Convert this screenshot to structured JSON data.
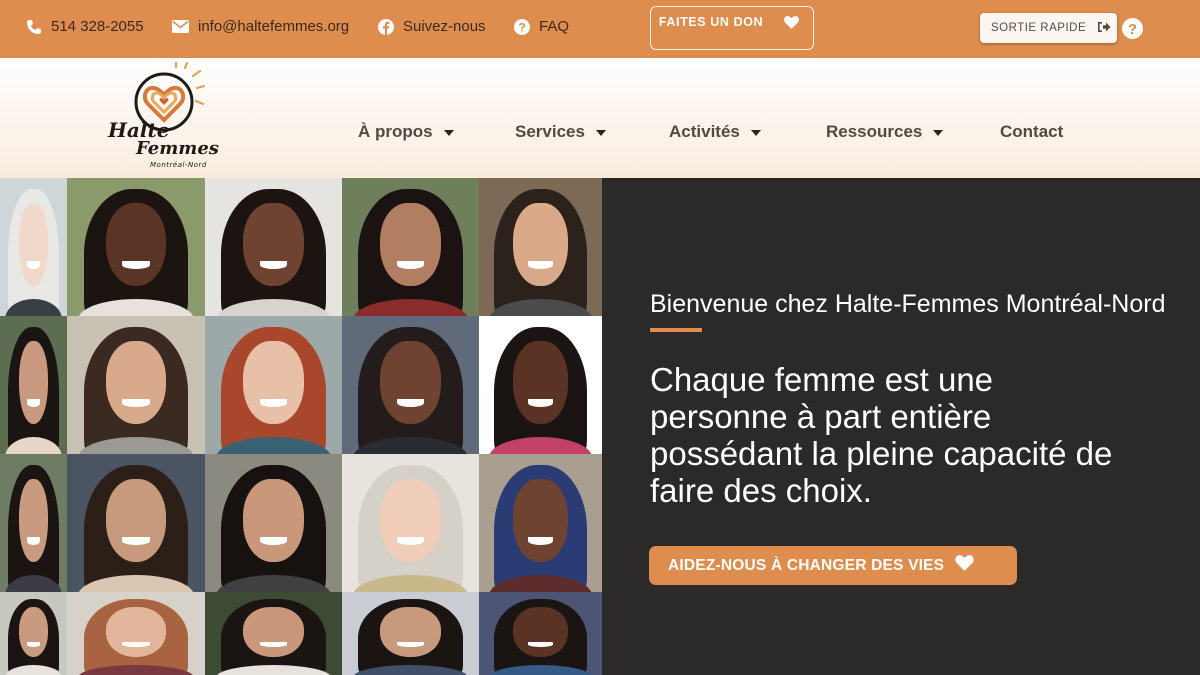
{
  "topbar": {
    "phone": "514 328-2055",
    "email": "info@haltefemmes.org",
    "social": "Suivez-nous",
    "faq": "FAQ",
    "donate_label": "FAITES UN DON",
    "quick_exit_label": "SORTIE RAPIDE"
  },
  "logo": {
    "text_line1": "Halte",
    "text_line2": "Femmes",
    "text_line3": "Montréal-Nord"
  },
  "nav": [
    {
      "label": "À propos"
    },
    {
      "label": "Services"
    },
    {
      "label": "Activités"
    },
    {
      "label": "Ressources"
    },
    {
      "label": "Contact"
    }
  ],
  "hero": {
    "welcome": "Bienvenue chez Halte-Femmes Montréal-Nord",
    "quote": "Chaque femme est une\npersonne à part entière\npossédant la pleine capacité de\nfaire des choix.",
    "cta_label": "AIDEZ-NOUS À CHANGER DES VIES"
  },
  "colors": {
    "accent": "#de8d4f",
    "dark_bg": "#2b2a29",
    "header_bg": "#faecdd"
  },
  "icons": [
    "phone-icon",
    "mail-icon",
    "facebook-icon",
    "question-icon",
    "heart-icon",
    "exit-icon",
    "help-icon"
  ]
}
